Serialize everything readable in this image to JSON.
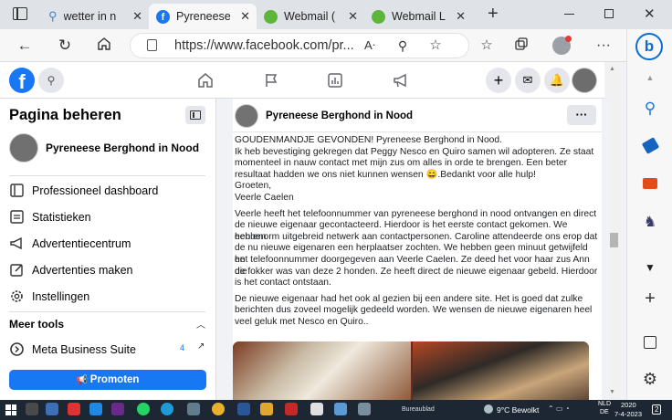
{
  "browser": {
    "tabs": [
      {
        "label": "wetter in n",
        "icon": "search-icon"
      },
      {
        "label": "Pyreneese",
        "icon": "facebook-icon"
      },
      {
        "label": "Webmail (",
        "icon": "webmail-icon"
      },
      {
        "label": "Webmail L",
        "icon": "webmail-icon"
      }
    ],
    "url": "https://www.facebook.com/pr..."
  },
  "sidebar": {
    "title": "Pagina beheren",
    "page_name": "Pyreneese Berghond in Nood",
    "items": [
      {
        "label": "Professioneel dashboard",
        "icon": "dashboard-icon"
      },
      {
        "label": "Statistieken",
        "icon": "stats-icon"
      },
      {
        "label": "Advertentiecentrum",
        "icon": "megaphone-icon"
      },
      {
        "label": "Advertenties maken",
        "icon": "edit-icon"
      },
      {
        "label": "Instellingen",
        "icon": "gear-icon"
      }
    ],
    "tools_header": "Meer tools",
    "meta_suite": "Meta Business Suite",
    "meta_count": "4",
    "promote_label": "Promoten"
  },
  "post": {
    "author": "Pyreneese Berghond in Nood",
    "more": "···",
    "lines": [
      "GOUDENMANDJE GEVONDEN!  Pyreneese Berghond in Nood.",
      "Ik heb bevestiging gekregen dat Peggy Nesco en Quiro samen wil adopteren. Ze staat",
      "momenteel in nauw contact met mijn zus om alles in orde te brengen. Een beter",
      "resultaat hadden we ons niet kunnen wensen 😄.Bedankt voor alle hulp!",
      "Groeten,",
      "Veerle Caelen",
      "",
      "Veerle heeft het telefoonnummer van pyreneese berghond in nood ontvangen en direct",
      "de nieuwe eigenaar gecontacteerd. Hierdoor is het eerste contact gekomen. We hebben",
      "een enorm uitgebreid netwerk aan contactpersonen.  Caroline attendeerde ons erop dat",
      "de nu nieuwe eigenaren een herplaatser zochten. We hebben geen minuut getwijfeld en",
      "het telefoonnummer doorgegeven aan Veerle Caelen. Ze deed het voor haar zus Ann die",
      "de fokker was van deze 2 honden. Ze heeft direct de nieuwe eigenaar gebeld. Hierdoor",
      "is het contact ontstaan.",
      "",
      "De nieuwe eigenaar had het ook al gezien bij een andere site. Het is goed dat zulke",
      "berichten dus zoveel mogelijk gedeeld worden. We wensen de nieuwe eigenaren heel",
      "veel geluk met Nesco en Quiro.."
    ]
  },
  "taskbar": {
    "desktop_label": "Bureaublad",
    "weather": "9°C  Bewolkt",
    "lang1": "NLD",
    "lang2": "DE",
    "time": "2020",
    "date": "7-4-2023",
    "notifications": "2"
  },
  "colors": {
    "fb_blue": "#1877f2",
    "edge_blue": "#0c6ed1",
    "taskbar": "#1c2733"
  }
}
